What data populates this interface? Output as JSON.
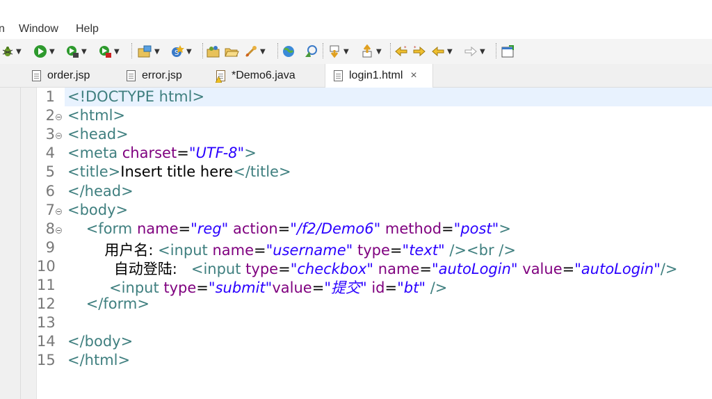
{
  "menu": {
    "partial": "n",
    "window": "Window",
    "help": "Help"
  },
  "toolbar_icons": [
    "debug-icon",
    "run-icon",
    "run-last-icon",
    "external-tools-icon",
    "new-project-icon",
    "new-class-icon",
    "open-type-icon",
    "open-folder-icon",
    "search-icon",
    "globe-icon",
    "tasks-icon",
    "next-annotation-icon",
    "previous-annotation-icon",
    "last-edit-icon",
    "back-icon",
    "forward-icon",
    "toggle-view-icon"
  ],
  "tabs": [
    {
      "label": "order.jsp",
      "icon": "jsp-file-icon"
    },
    {
      "label": "error.jsp",
      "icon": "jsp-file-icon"
    },
    {
      "label": "*Demo6.java",
      "icon": "java-file-warning-icon"
    },
    {
      "label": "login1.html",
      "icon": "html-file-icon",
      "active": true
    }
  ],
  "close_glyph": "×",
  "colors": {
    "tag": "#3f7f7f",
    "attribute": "#7f007f",
    "value": "#2a00ff",
    "text": "#000000",
    "current_line": "#e8f2fe"
  },
  "editor": {
    "line_numbers": [
      "1",
      "2",
      "3",
      "4",
      "5",
      "6",
      "7",
      "8",
      "9",
      "10",
      "11",
      "12",
      "13",
      "14",
      "15"
    ],
    "lines": [
      [
        {
          "t": "tg",
          "s": "<!DOCTYPE html>"
        }
      ],
      [
        {
          "t": "tg",
          "s": "<html>"
        }
      ],
      [
        {
          "t": "tg",
          "s": "<head>"
        }
      ],
      [
        {
          "t": "tg",
          "s": "<meta "
        },
        {
          "t": "at",
          "s": "charset"
        },
        {
          "t": "tx",
          "s": "="
        },
        {
          "t": "vl",
          "s": "\"UTF-8\""
        },
        {
          "t": "tg",
          "s": ">"
        }
      ],
      [
        {
          "t": "tg",
          "s": "<title>"
        },
        {
          "t": "tx",
          "s": "Insert title here"
        },
        {
          "t": "tg",
          "s": "</title>"
        }
      ],
      [
        {
          "t": "tg",
          "s": "</head>"
        }
      ],
      [
        {
          "t": "tg",
          "s": "<body>"
        }
      ],
      [
        {
          "t": "tx",
          "s": "    "
        },
        {
          "t": "tg",
          "s": "<form "
        },
        {
          "t": "at",
          "s": "name"
        },
        {
          "t": "tx",
          "s": "="
        },
        {
          "t": "vl",
          "s": "\"reg\""
        },
        {
          "t": "tx",
          "s": " "
        },
        {
          "t": "at",
          "s": "action"
        },
        {
          "t": "tx",
          "s": "="
        },
        {
          "t": "vl",
          "s": "\"/f2/Demo6\""
        },
        {
          "t": "tx",
          "s": " "
        },
        {
          "t": "at",
          "s": "method"
        },
        {
          "t": "tx",
          "s": "="
        },
        {
          "t": "vl",
          "s": "\"post\""
        },
        {
          "t": "tg",
          "s": ">"
        }
      ],
      [
        {
          "t": "tx",
          "s": "        用户名: "
        },
        {
          "t": "tg",
          "s": "<input "
        },
        {
          "t": "at",
          "s": "name"
        },
        {
          "t": "tx",
          "s": "="
        },
        {
          "t": "vl",
          "s": "\"username\""
        },
        {
          "t": "tx",
          "s": " "
        },
        {
          "t": "at",
          "s": "type"
        },
        {
          "t": "tx",
          "s": "="
        },
        {
          "t": "vl",
          "s": "\"text\""
        },
        {
          "t": "tx",
          "s": " "
        },
        {
          "t": "tg",
          "s": "/><br />"
        }
      ],
      [
        {
          "t": "tx",
          "s": "          自动登陆:   "
        },
        {
          "t": "tg",
          "s": "<input "
        },
        {
          "t": "at",
          "s": "type"
        },
        {
          "t": "tx",
          "s": "="
        },
        {
          "t": "vl",
          "s": "\"checkbox\""
        },
        {
          "t": "tx",
          "s": " "
        },
        {
          "t": "at",
          "s": "name"
        },
        {
          "t": "tx",
          "s": "="
        },
        {
          "t": "vl",
          "s": "\"autoLogin\""
        },
        {
          "t": "tx",
          "s": " "
        },
        {
          "t": "at",
          "s": "value"
        },
        {
          "t": "tx",
          "s": "="
        },
        {
          "t": "vl",
          "s": "\"autoLogin\""
        },
        {
          "t": "tg",
          "s": "/>"
        }
      ],
      [
        {
          "t": "tx",
          "s": "         "
        },
        {
          "t": "tg",
          "s": "<input "
        },
        {
          "t": "at",
          "s": "type"
        },
        {
          "t": "tx",
          "s": "="
        },
        {
          "t": "vl",
          "s": "\"submit\""
        },
        {
          "t": "at",
          "s": "value"
        },
        {
          "t": "tx",
          "s": "="
        },
        {
          "t": "vl",
          "s": "\"提交\""
        },
        {
          "t": "tx",
          "s": " "
        },
        {
          "t": "at",
          "s": "id"
        },
        {
          "t": "tx",
          "s": "="
        },
        {
          "t": "vl",
          "s": "\"bt\""
        },
        {
          "t": "tx",
          "s": " "
        },
        {
          "t": "tg",
          "s": "/>"
        }
      ],
      [
        {
          "t": "tx",
          "s": "    "
        },
        {
          "t": "tg",
          "s": "</form>"
        }
      ],
      [],
      [
        {
          "t": "tg",
          "s": "</body>"
        }
      ],
      [
        {
          "t": "tg",
          "s": "</html>"
        }
      ]
    ]
  }
}
